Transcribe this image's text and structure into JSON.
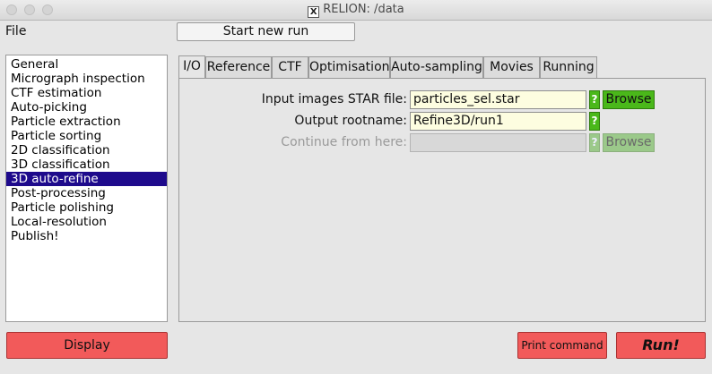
{
  "window": {
    "title": "RELION: /data",
    "x_glyph": "X"
  },
  "menu": {
    "file": "File"
  },
  "toolbar": {
    "start_new_run": "Start new run"
  },
  "job_list": {
    "items": [
      {
        "label": "General"
      },
      {
        "label": "Micrograph inspection"
      },
      {
        "label": "CTF estimation"
      },
      {
        "label": "Auto-picking"
      },
      {
        "label": "Particle extraction"
      },
      {
        "label": "Particle sorting"
      },
      {
        "label": "2D classification"
      },
      {
        "label": "3D classification"
      },
      {
        "label": "3D auto-refine"
      },
      {
        "label": "Post-processing"
      },
      {
        "label": "Particle polishing"
      },
      {
        "label": "Local-resolution"
      },
      {
        "label": "Publish!"
      }
    ],
    "selected": "3D auto-refine"
  },
  "tabs": [
    {
      "label": "I/O"
    },
    {
      "label": "Reference"
    },
    {
      "label": "CTF"
    },
    {
      "label": "Optimisation"
    },
    {
      "label": "Auto-sampling"
    },
    {
      "label": "Movies"
    },
    {
      "label": "Running"
    }
  ],
  "active_tab": "I/O",
  "io": {
    "input_images": {
      "label": "Input images STAR file:",
      "value": "particles_sel.star",
      "help": "?",
      "browse": "Browse"
    },
    "output_rootname": {
      "label": "Output rootname:",
      "value": "Refine3D/run1",
      "help": "?"
    },
    "continue_from": {
      "label": "Continue from here:",
      "value": "",
      "help": "?",
      "browse": "Browse"
    }
  },
  "buttons": {
    "display": "Display",
    "print_command": "Print command",
    "run": "Run!"
  },
  "colors": {
    "selection": "#1e0a8c",
    "field_bg": "#fdfde0",
    "help_green": "#4ab81a",
    "button_red": "#f25a5a"
  }
}
